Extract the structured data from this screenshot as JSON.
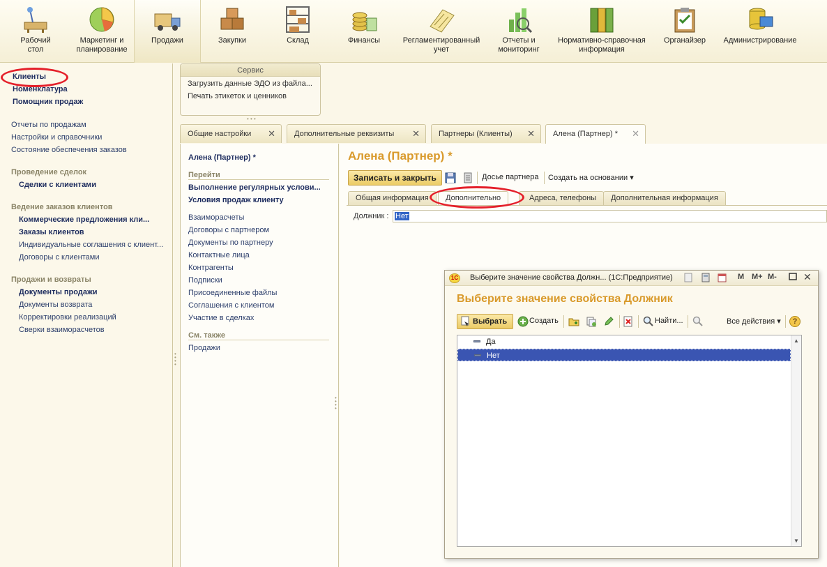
{
  "sections": [
    {
      "id": "desktop",
      "label1": "Рабочий",
      "label2": "стол"
    },
    {
      "id": "marketing",
      "label1": "Маркетинг и",
      "label2": "планирование"
    },
    {
      "id": "sales",
      "label1": "Продажи",
      "label2": ""
    },
    {
      "id": "purchases",
      "label1": "Закупки",
      "label2": ""
    },
    {
      "id": "warehouse",
      "label1": "Склад",
      "label2": ""
    },
    {
      "id": "finance",
      "label1": "Финансы",
      "label2": ""
    },
    {
      "id": "regulated",
      "label1": "Регламентированный",
      "label2": "учет"
    },
    {
      "id": "reports",
      "label1": "Отчеты и",
      "label2": "мониторинг"
    },
    {
      "id": "reference",
      "label1": "Нормативно-справочная",
      "label2": "информация"
    },
    {
      "id": "organizer",
      "label1": "Органайзер",
      "label2": ""
    },
    {
      "id": "admin",
      "label1": "Администрирование",
      "label2": ""
    }
  ],
  "left_panel": {
    "clients": "Клиенты",
    "nomenclature": "Номенклатура",
    "sales_assistant": "Помощник продаж",
    "sales_reports": "Отчеты по продажам",
    "settings_refs": "Настройки и справочники",
    "order_status": "Состояние обеспечения заказов",
    "deals_head": "Проведение сделок",
    "client_deals": "Сделки с клиентами",
    "orders_head": "Ведение заказов клиентов",
    "commercial_offers": "Коммерческие предложения кли...",
    "client_orders": "Заказы клиентов",
    "individual_agreements": "Индивидуальные соглашения с клиент...",
    "client_contracts": "Договоры с клиентами",
    "sales_returns_head": "Продажи и возвраты",
    "sales_docs": "Документы продажи",
    "return_docs": "Документы возврата",
    "sales_corrections": "Корректировки реализаций",
    "reconciliations": "Сверки взаиморасчетов"
  },
  "service": {
    "title": "Сервис",
    "item1": "Загрузить данные ЭДО из файла...",
    "item2": "Печать этикеток и ценников"
  },
  "tabs": [
    {
      "label": "Общие настройки",
      "close": "✕"
    },
    {
      "label": "Дополнительные реквизиты",
      "close": "✕"
    },
    {
      "label": "Партнеры (Клиенты)",
      "close": "✕"
    },
    {
      "label": "Алена (Партнер) *",
      "close": "✕"
    }
  ],
  "nav_panel": {
    "title": "Алена (Партнер) *",
    "goto_head": "Перейти",
    "regular_conditions": "Выполнение регулярных услови...",
    "sales_conditions": "Условия продаж клиенту",
    "settlements": "Взаиморасчеты",
    "partner_contracts": "Договоры с партнером",
    "partner_docs": "Документы по партнеру",
    "contacts": "Контактные лица",
    "counterparties": "Контрагенты",
    "subscriptions": "Подписки",
    "attached_files": "Присоединенные файлы",
    "client_agreements": "Соглашения с клиентом",
    "deals_participation": "Участие в сделках",
    "see_also_head": "См. также",
    "sales": "Продажи"
  },
  "form": {
    "title": "Алена (Партнер) *",
    "save_close": "Записать и закрыть",
    "dossier": "Досье партнера",
    "create_based": "Создать на основании",
    "tab_general": "Общая информация",
    "tab_additional": "Дополнительно",
    "tab_addresses": "Адреса, телефоны",
    "tab_add_info": "Дополнительная информация",
    "field_label": "Должник :",
    "field_value": "Нет"
  },
  "dialog": {
    "window_title": "Выберите значение свойства Должн...  (1С:Предприятие)",
    "logo": "1С",
    "m": "M",
    "m_plus": "M+",
    "m_minus": "M-",
    "heading": "Выберите значение свойства Должник",
    "choose": "Выбрать",
    "create": "Создать",
    "find": "Найти...",
    "all_actions": "Все действия",
    "help": "?",
    "rows": [
      "Да",
      "Нет"
    ]
  },
  "colors": {
    "accent_title": "#d99a2b",
    "highlight_red": "#e4202a",
    "selection": "#3a55b2"
  }
}
